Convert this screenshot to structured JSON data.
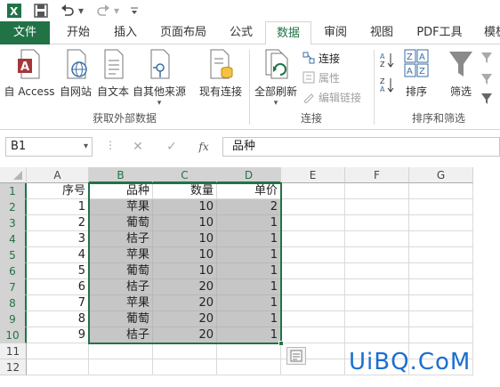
{
  "ribbon_tabs": [
    "文件",
    "开始",
    "插入",
    "页面布局",
    "公式",
    "数据",
    "审阅",
    "视图",
    "PDF工具",
    "模板"
  ],
  "active_tab": "数据",
  "ribbon": {
    "get_external": {
      "buttons": [
        "自 Access",
        "自网站",
        "自文本",
        "自其他来源"
      ],
      "existing": "现有连接",
      "label": "获取外部数据"
    },
    "connections": {
      "refresh": "全部刷新",
      "items": [
        "连接",
        "属性",
        "编辑链接"
      ],
      "label": "连接"
    },
    "sort": {
      "sort_btn": "排序",
      "filter_btn": "筛选",
      "label": "排序和筛选"
    }
  },
  "formula_bar": {
    "name_box": "B1",
    "fx": "fx",
    "value": "品种"
  },
  "columns": [
    "A",
    "B",
    "C",
    "D",
    "E",
    "F",
    "G"
  ],
  "rows": [
    "1",
    "2",
    "3",
    "4",
    "5",
    "6",
    "7",
    "8",
    "9",
    "10",
    "11",
    "12"
  ],
  "table": {
    "headers": [
      "序号",
      "品种",
      "数量",
      "单价"
    ],
    "data": [
      [
        "1",
        "苹果",
        "10",
        "2"
      ],
      [
        "2",
        "葡萄",
        "10",
        "1"
      ],
      [
        "3",
        "桔子",
        "10",
        "1"
      ],
      [
        "4",
        "苹果",
        "10",
        "1"
      ],
      [
        "5",
        "葡萄",
        "10",
        "1"
      ],
      [
        "6",
        "桔子",
        "20",
        "1"
      ],
      [
        "7",
        "苹果",
        "20",
        "1"
      ],
      [
        "8",
        "葡萄",
        "20",
        "1"
      ],
      [
        "9",
        "桔子",
        "20",
        "1"
      ]
    ]
  },
  "watermark": "UiBQ.CoM",
  "colors": {
    "excel_green": "#217346",
    "selection_fill": "#c6c6c6"
  }
}
